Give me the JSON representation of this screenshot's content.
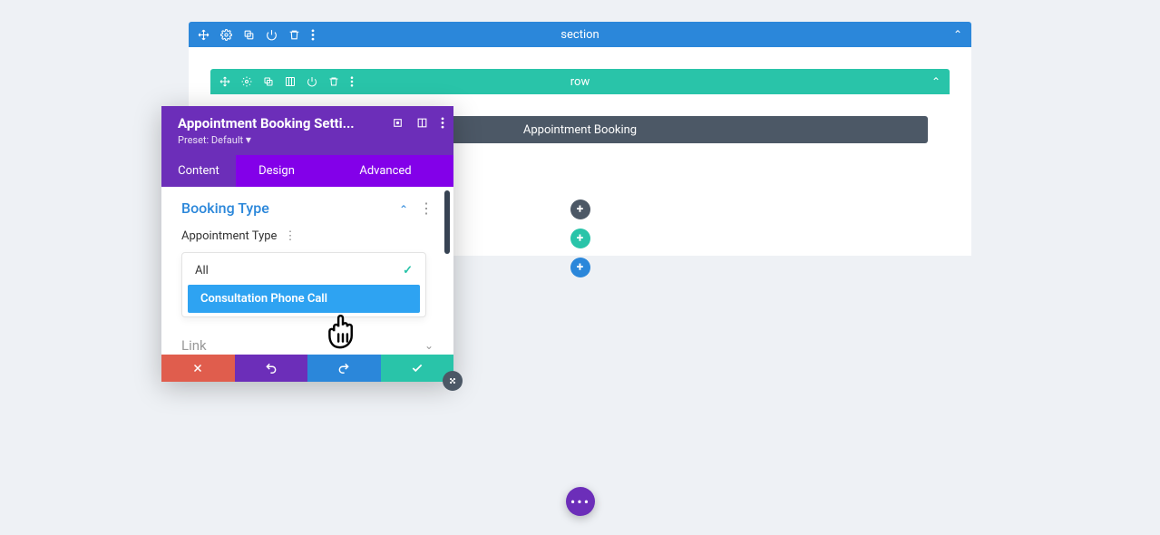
{
  "section": {
    "label": "section"
  },
  "row": {
    "label": "row"
  },
  "module": {
    "label": "Appointment Booking"
  },
  "modal": {
    "title": "Appointment Booking Setti...",
    "preset": "Preset: Default",
    "tabs": {
      "content": "Content",
      "design": "Design",
      "advanced": "Advanced"
    },
    "booking_type": "Booking Type",
    "appointment_type": "Appointment Type",
    "options": {
      "all": "All",
      "consult": "Consultation Phone Call"
    },
    "link": "Link"
  },
  "fab": "•••"
}
